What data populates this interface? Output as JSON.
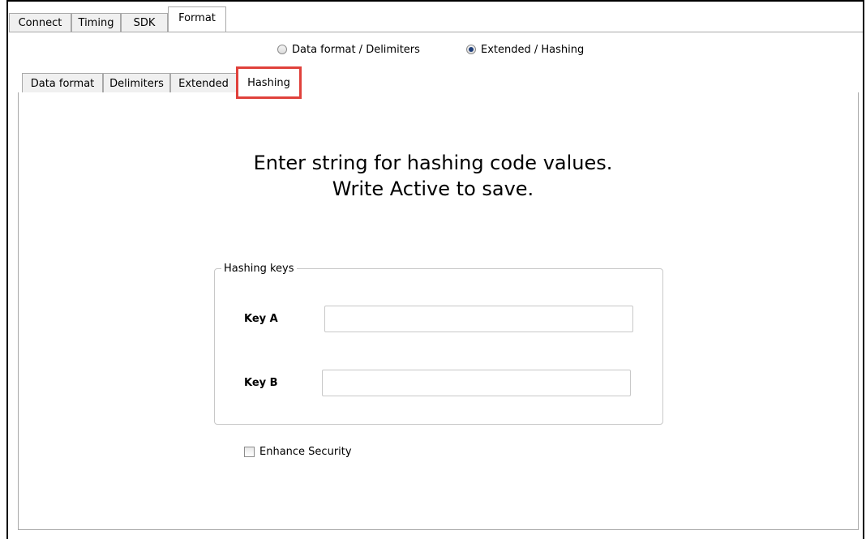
{
  "top_tabs": [
    {
      "label": "Connect",
      "active": false
    },
    {
      "label": "Timing",
      "active": false
    },
    {
      "label": "SDK",
      "active": false
    },
    {
      "label": "Format",
      "active": true
    }
  ],
  "mode_options": [
    {
      "label": "Data format / Delimiters",
      "checked": false
    },
    {
      "label": "Extended / Hashing",
      "checked": true
    }
  ],
  "sub_tabs": [
    {
      "label": "Data format",
      "active": false
    },
    {
      "label": "Delimiters",
      "active": false
    },
    {
      "label": "Extended",
      "active": false
    },
    {
      "label": "Hashing",
      "active": true
    }
  ],
  "message": {
    "line1": "Enter string for hashing code values.",
    "line2": "Write Active to save."
  },
  "hashing_keys": {
    "legend": "Hashing keys",
    "key_a": {
      "label": "Key A",
      "value": ""
    },
    "key_b": {
      "label": "Key B",
      "value": ""
    }
  },
  "enhance_security": {
    "label": "Enhance Security",
    "checked": false
  },
  "colors": {
    "highlight": "#e0413b",
    "tab_border": "#a9a9a9"
  }
}
